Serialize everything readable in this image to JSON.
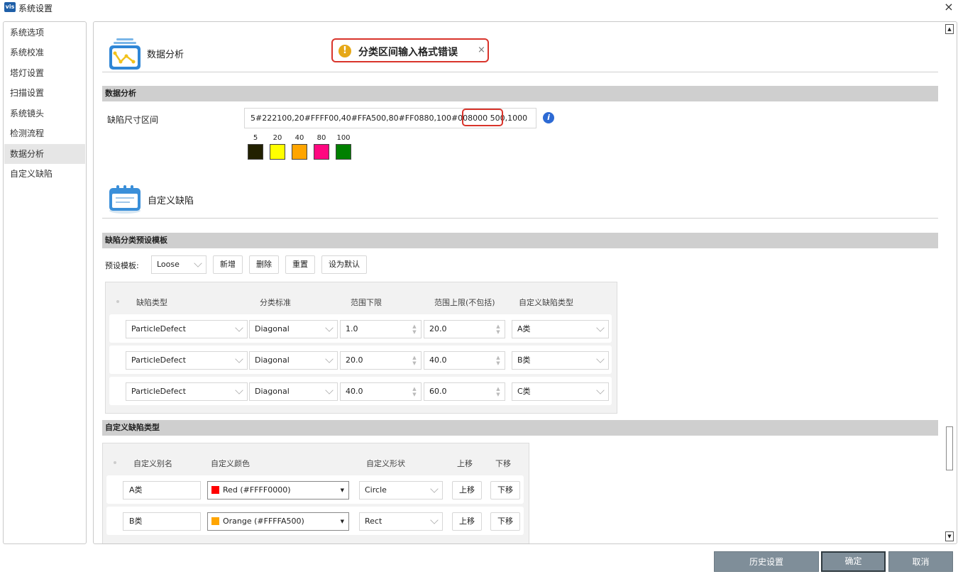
{
  "window": {
    "app_logo": "vis",
    "title": "系统设置"
  },
  "nav": {
    "items": [
      "系统选项",
      "系统校准",
      "塔灯设置",
      "扫描设置",
      "系统镜头",
      "检测流程",
      "数据分析",
      "自定义缺陷"
    ],
    "active_index": 6
  },
  "toast": {
    "message": "分类区间输入格式错误",
    "icon": "!",
    "close": "×"
  },
  "sections": {
    "data_analysis": "数据分析",
    "custom_defect": "自定义缺陷"
  },
  "data_analysis": {
    "band_title": "数据分析",
    "range_label": "缺陷尺寸区间",
    "range_value": "5#222100,20#FFFF00,40#FFA500,80#FF0880,100#008000 500,1000",
    "range_invalid_part": "500,1000",
    "info": "i",
    "swatches": [
      {
        "label": "5",
        "color": "#222100"
      },
      {
        "label": "20",
        "color": "#FFFF00"
      },
      {
        "label": "40",
        "color": "#FFA500"
      },
      {
        "label": "80",
        "color": "#FF0880"
      },
      {
        "label": "100",
        "color": "#008000"
      }
    ]
  },
  "template": {
    "band_title": "缺陷分类预设模板",
    "preset_label": "预设模板:",
    "preset_value": "Loose",
    "buttons": {
      "add": "新增",
      "delete": "删除",
      "reset": "重置",
      "set_default": "设为默认"
    },
    "headers": [
      "缺陷类型",
      "分类标准",
      "范围下限",
      "范围上限(不包括)",
      "自定义缺陷类型"
    ],
    "rows": [
      {
        "defect_type": "ParticleDefect",
        "standard": "Diagonal",
        "lower": "1.0",
        "upper": "20.0",
        "custom_type": "A类"
      },
      {
        "defect_type": "ParticleDefect",
        "standard": "Diagonal",
        "lower": "20.0",
        "upper": "40.0",
        "custom_type": "B类"
      },
      {
        "defect_type": "ParticleDefect",
        "standard": "Diagonal",
        "lower": "40.0",
        "upper": "60.0",
        "custom_type": "C类"
      }
    ]
  },
  "custom_types": {
    "band_title": "自定义缺陷类型",
    "headers": [
      "自定义别名",
      "自定义颜色",
      "自定义形状",
      "上移",
      "下移"
    ],
    "rows": [
      {
        "alias": "A类",
        "color_label": "Red (#FFFF0000)",
        "color": "#FF0000",
        "shape": "Circle",
        "up": "上移",
        "down": "下移"
      },
      {
        "alias": "B类",
        "color_label": "Orange (#FFFFA500)",
        "color": "#FFA500",
        "shape": "Rect",
        "up": "上移",
        "down": "下移"
      }
    ]
  },
  "footer": {
    "history": "历史设置",
    "ok": "确定",
    "cancel": "取消"
  }
}
